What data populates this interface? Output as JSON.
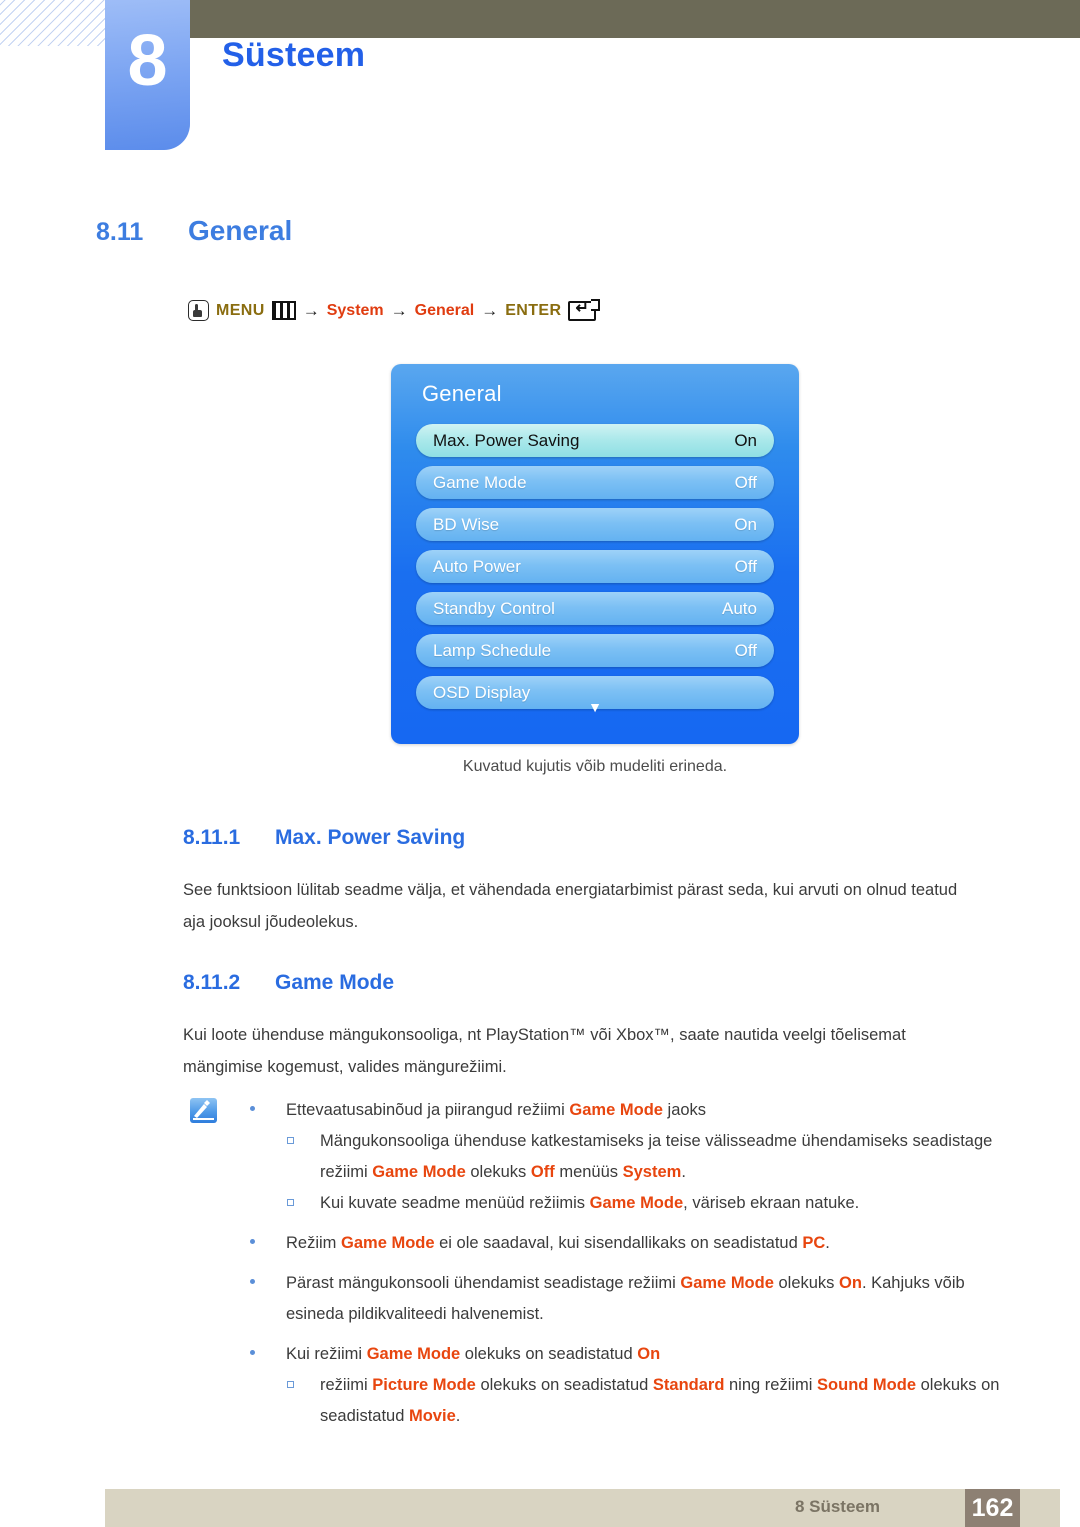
{
  "header": {
    "chapter_number": "8",
    "chapter_title": "Süsteem"
  },
  "section": {
    "number": "8.11",
    "title": "General"
  },
  "menu_path": {
    "hand_icon": "hand-press-icon",
    "menu_label": "MENU",
    "menu_icon": "menu-bars-icon",
    "arrow1": "→",
    "item1": "System",
    "arrow2": "→",
    "item2": "General",
    "arrow3": "→",
    "enter_label": "ENTER",
    "enter_icon": "enter-key-icon"
  },
  "osd": {
    "title": "General",
    "items": [
      {
        "label": "Max. Power Saving",
        "value": "On",
        "selected": true
      },
      {
        "label": "Game Mode",
        "value": "Off",
        "selected": false
      },
      {
        "label": "BD Wise",
        "value": "On",
        "selected": false
      },
      {
        "label": "Auto Power",
        "value": "Off",
        "selected": false
      },
      {
        "label": "Standby Control",
        "value": "Auto",
        "selected": false
      },
      {
        "label": "Lamp Schedule",
        "value": "Off",
        "selected": false
      },
      {
        "label": "OSD Display",
        "value": "",
        "selected": false
      }
    ],
    "scroll_arrow": "▼",
    "caption": "Kuvatud kujutis võib mudeliti erineda.",
    "accent_color": "#1668f2",
    "selected_color": "#a9e8ea"
  },
  "subsections": [
    {
      "number": "8.11.1",
      "title": "Max. Power Saving",
      "paragraph": "See funktsioon lülitab seadme välja, et vähendada energiatarbimist pärast seda, kui arvuti on olnud teatud aja jooksul jõudeolekus."
    },
    {
      "number": "8.11.2",
      "title": "Game Mode",
      "paragraph": "Kui loote ühenduse mängukonsooliga, nt PlayStation™ või Xbox™, saate nautida veelgi tõelisemat mängimise kogemust, valides mängurežiimi."
    }
  ],
  "note": {
    "icon": "note-pencil-icon",
    "bullets": [
      {
        "level": 1,
        "segments": [
          {
            "t": "Ettevaatusabinõud ja piirangud režiimi ",
            "h": false
          },
          {
            "t": "Game Mode",
            "h": true
          },
          {
            "t": " jaoks",
            "h": false
          }
        ]
      },
      {
        "level": 2,
        "segments": [
          {
            "t": "Mängukonsooliga ühenduse katkestamiseks ja teise välisseadme ühendamiseks seadistage režiimi ",
            "h": false
          },
          {
            "t": "Game Mode",
            "h": true
          },
          {
            "t": " olekuks ",
            "h": false
          },
          {
            "t": "Off",
            "h": true
          },
          {
            "t": " menüüs ",
            "h": false
          },
          {
            "t": "System",
            "h": true
          },
          {
            "t": ".",
            "h": false
          }
        ]
      },
      {
        "level": 2,
        "segments": [
          {
            "t": "Kui kuvate seadme menüüd režiimis ",
            "h": false
          },
          {
            "t": "Game Mode",
            "h": true
          },
          {
            "t": ", väriseb ekraan natuke.",
            "h": false
          }
        ]
      },
      {
        "level": 1,
        "segments": [
          {
            "t": "Režiim ",
            "h": false
          },
          {
            "t": "Game Mode",
            "h": true
          },
          {
            "t": " ei ole saadaval, kui sisendallikaks on seadistatud ",
            "h": false
          },
          {
            "t": "PC",
            "h": true
          },
          {
            "t": ".",
            "h": false
          }
        ]
      },
      {
        "level": 1,
        "segments": [
          {
            "t": "Pärast mängukonsooli ühendamist seadistage režiimi ",
            "h": false
          },
          {
            "t": "Game Mode",
            "h": true
          },
          {
            "t": " olekuks ",
            "h": false
          },
          {
            "t": "On",
            "h": true
          },
          {
            "t": ". Kahjuks võib esineda pildikvaliteedi halvenemist.",
            "h": false
          }
        ]
      },
      {
        "level": 1,
        "segments": [
          {
            "t": "Kui režiimi ",
            "h": false
          },
          {
            "t": "Game Mode",
            "h": true
          },
          {
            "t": " olekuks on seadistatud ",
            "h": false
          },
          {
            "t": "On",
            "h": true
          }
        ]
      },
      {
        "level": 2,
        "segments": [
          {
            "t": "režiimi ",
            "h": false
          },
          {
            "t": "Picture Mode",
            "h": true
          },
          {
            "t": " olekuks on seadistatud ",
            "h": false
          },
          {
            "t": "Standard",
            "h": true
          },
          {
            "t": " ning režiimi ",
            "h": false
          },
          {
            "t": "Sound Mode",
            "h": true
          },
          {
            "t": " olekuks on seadistatud ",
            "h": false
          },
          {
            "t": "Movie",
            "h": true
          },
          {
            "t": ".",
            "h": false
          }
        ]
      }
    ],
    "highlight_color": "#e8460f"
  },
  "footer": {
    "label": "8 Süsteem",
    "page_number": "162"
  }
}
